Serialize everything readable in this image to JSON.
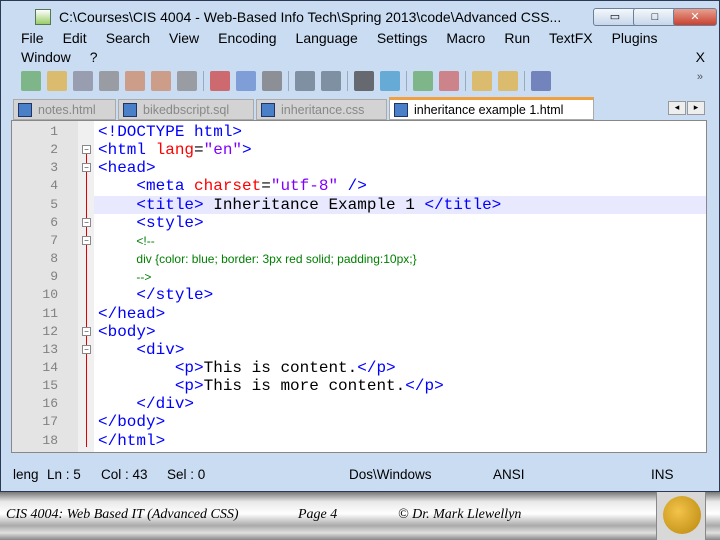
{
  "window": {
    "title": "C:\\Courses\\CIS 4004 - Web-Based Info Tech\\Spring 2013\\code\\Advanced CSS...",
    "min": "▭",
    "max": "□",
    "close": "✕"
  },
  "menu": {
    "row1": [
      "File",
      "Edit",
      "Search",
      "View",
      "Encoding",
      "Language",
      "Settings",
      "Macro",
      "Run",
      "TextFX",
      "Plugins"
    ],
    "row2": [
      "Window",
      "?"
    ],
    "close_doc": "X"
  },
  "toolbar": {
    "icons": [
      "new-file",
      "open-file",
      "save",
      "save-all",
      "close",
      "close-all",
      "print",
      "cut",
      "copy",
      "paste",
      "undo",
      "redo",
      "find",
      "replace",
      "zoom-in",
      "zoom-out",
      "sync-vertical",
      "sync-horizontal",
      "word-wrap"
    ],
    "overflow": "»"
  },
  "tabs": [
    {
      "label": "notes.html"
    },
    {
      "label": "bikedbscript.sql"
    },
    {
      "label": "inheritance.css"
    },
    {
      "label": "inheritance example 1.html",
      "active": true
    }
  ],
  "tab_nav": {
    "left": "◂",
    "right": "▸"
  },
  "editor": {
    "current_line": 5,
    "lines": [
      [
        [
          "tag",
          "<!DOCTYPE html>"
        ]
      ],
      [
        [
          "tag",
          "<html "
        ],
        [
          "attr",
          "lang"
        ],
        [
          "text",
          "="
        ],
        [
          "val",
          "\"en\""
        ],
        [
          "tag",
          ">"
        ]
      ],
      [
        [
          "tag",
          "<head>"
        ]
      ],
      [
        [
          "text",
          "    "
        ],
        [
          "tag",
          "<meta "
        ],
        [
          "attr",
          "charset"
        ],
        [
          "text",
          "="
        ],
        [
          "val",
          "\"utf-8\""
        ],
        [
          "tag",
          " />"
        ]
      ],
      [
        [
          "text",
          "    "
        ],
        [
          "tag",
          "<title>"
        ],
        [
          "text",
          " Inheritance Example 1 "
        ],
        [
          "tag",
          "</title>"
        ]
      ],
      [
        [
          "text",
          "    "
        ],
        [
          "tag",
          "<style>"
        ]
      ],
      [
        [
          "text",
          "    "
        ],
        [
          "com",
          "<!--"
        ]
      ],
      [
        [
          "text",
          "    "
        ],
        [
          "com",
          "div {color: blue; border: 3px red solid; padding:10px;}"
        ]
      ],
      [
        [
          "text",
          "    "
        ],
        [
          "com",
          "-->"
        ]
      ],
      [
        [
          "text",
          "    "
        ],
        [
          "tag",
          "</style>"
        ]
      ],
      [
        [
          "tag",
          "</head>"
        ]
      ],
      [
        [
          "tag",
          "<body>"
        ]
      ],
      [
        [
          "text",
          "    "
        ],
        [
          "tag",
          "<div>"
        ]
      ],
      [
        [
          "text",
          "        "
        ],
        [
          "tag",
          "<p>"
        ],
        [
          "text",
          "This is content."
        ],
        [
          "tag",
          "</p>"
        ]
      ],
      [
        [
          "text",
          "        "
        ],
        [
          "tag",
          "<p>"
        ],
        [
          "text",
          "This is more content."
        ],
        [
          "tag",
          "</p>"
        ]
      ],
      [
        [
          "text",
          "    "
        ],
        [
          "tag",
          "</div>"
        ]
      ],
      [
        [
          "tag",
          "</body>"
        ]
      ],
      [
        [
          "tag",
          "</html>"
        ]
      ]
    ]
  },
  "status": {
    "type": "leng",
    "ln": "Ln : 5",
    "col": "Col : 43",
    "sel": "Sel : 0",
    "eol": "Dos\\Windows",
    "encoding": "ANSI",
    "mode": "INS"
  },
  "footer": {
    "course": "CIS 4004: Web Based IT (Advanced CSS)",
    "page": "Page 4",
    "author": "© Dr. Mark Llewellyn"
  }
}
